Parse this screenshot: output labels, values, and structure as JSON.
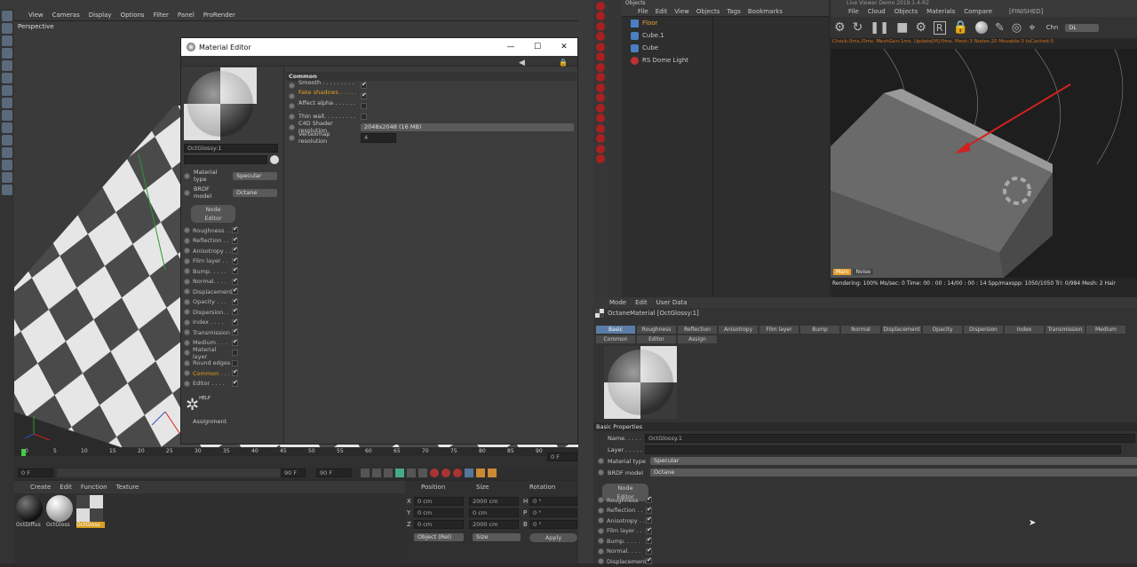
{
  "viewport": {
    "menu": [
      "View",
      "Cameras",
      "Display",
      "Options",
      "Filter",
      "Panel",
      "ProRender"
    ],
    "label": "Perspective"
  },
  "timeline": {
    "ticks": [
      "0",
      "5",
      "10",
      "15",
      "20",
      "25",
      "30",
      "35",
      "40",
      "45",
      "50",
      "55",
      "60",
      "65",
      "70",
      "75",
      "80",
      "85",
      "90"
    ],
    "end_field": "0 F",
    "start_field": "0 F",
    "range_end": "90 F",
    "current": "90 F",
    "range_start": "0 F"
  },
  "material_manager": {
    "menu": [
      "Create",
      "Edit",
      "Function",
      "Texture"
    ],
    "materials": [
      {
        "name": "OctDiffus"
      },
      {
        "name": "OctGloss"
      },
      {
        "name": "OctGloss",
        "selected": true
      }
    ]
  },
  "coordinates": {
    "headers": [
      "Position",
      "Size",
      "Rotation"
    ],
    "rows": [
      {
        "axis": "X",
        "pos": "0 cm",
        "size": "2000 cm",
        "rot_axis": "H",
        "rot": "0 °"
      },
      {
        "axis": "Y",
        "pos": "0 cm",
        "size": "0 cm",
        "rot_axis": "P",
        "rot": "0 °"
      },
      {
        "axis": "Z",
        "pos": "0 cm",
        "size": "2000 cm",
        "rot_axis": "B",
        "rot": "0 °"
      }
    ],
    "mode_drop": "Object (Rel)",
    "size_drop": "Size",
    "apply": "Apply"
  },
  "material_editor": {
    "title": "Material Editor",
    "window_controls": {
      "minimize": "—",
      "maximize": "☐",
      "close": "✕"
    },
    "name": "OctGlossy:1",
    "material_type_label": "Material type",
    "material_type": "Specular",
    "brdf_label": "BRDF model",
    "brdf": "Octane",
    "node_editor": "Node Editor",
    "channels": [
      {
        "label": "Roughness . .",
        "checked": true
      },
      {
        "label": "Reflection . .",
        "checked": true
      },
      {
        "label": "Anisotropy . .",
        "checked": true
      },
      {
        "label": "Film layer . .",
        "checked": true
      },
      {
        "label": "Bump. . . . .",
        "checked": true
      },
      {
        "label": "Normal. . . .",
        "checked": true
      },
      {
        "label": "Displacement",
        "checked": true
      },
      {
        "label": "Opacity . . .",
        "checked": true
      },
      {
        "label": "Dispersion. .",
        "checked": true
      },
      {
        "label": "Index . . . .",
        "checked": true
      },
      {
        "label": "Transmission",
        "checked": true
      },
      {
        "label": "Medium . . .",
        "checked": true
      },
      {
        "label": "Material layer",
        "checked": false
      },
      {
        "label": "Round edges",
        "checked": false
      },
      {
        "label": "Common . . .",
        "checked": true,
        "highlight": true
      },
      {
        "label": "Editor . . . .",
        "checked": true
      }
    ],
    "help": "HELP",
    "assignment": "Assignment",
    "section": "Common",
    "props": [
      {
        "label": "Smooth . . . . . . . . . .",
        "checked": true
      },
      {
        "label": "Fake shadows . . . . . .",
        "checked": true,
        "highlight": true
      },
      {
        "label": "Affect alpha . . . . . . .",
        "checked": false
      },
      {
        "label": "Thin wall. . . . . . . . .",
        "checked": false
      }
    ],
    "shader_res_label": "C4D Shader resolution",
    "shader_res": "2048x2048 (16 MB)",
    "vertexmap_label": "Vertexmap resolution",
    "vertexmap": "4"
  },
  "object_manager": {
    "title": "Objects",
    "menu": [
      "File",
      "Edit",
      "View",
      "Objects",
      "Tags",
      "Bookmarks"
    ],
    "objects": [
      {
        "name": "Floor",
        "highlight": true
      },
      {
        "name": "Cube.1"
      },
      {
        "name": "Cube"
      },
      {
        "name": "RS Dome Light"
      }
    ]
  },
  "live_viewer": {
    "title": "Live Viewer Demo 2019.1.4-R2",
    "menu": [
      "File",
      "Cloud",
      "Objects",
      "Materials",
      "Compare"
    ],
    "status_tag": "[FINISHED]",
    "channel_label": "Chn",
    "channel": "DL",
    "info_line": "Check:0ms./0ms. MeshGen:1ms. Update[M]:0ms. Mesh:3 Nodes:20 Movable:3 txCached:0",
    "tag_main": "Main",
    "tag_noise": "Noise",
    "render_status": "Rendering: 100%  Ms/sec: 0    Time: 00 : 00 : 14/00 : 00 : 14   Spp/maxspp: 1050/1050    Tri: 0/984    Mesh: 2   Hair"
  },
  "attributes": {
    "menu": [
      "Mode",
      "Edit",
      "User Data"
    ],
    "header": "OctaneMaterial [OctGlossy:1]",
    "tabs_row1": [
      "Basic",
      "Roughness",
      "Reflection",
      "Anisotropy",
      "Film layer",
      "Bump",
      "Normal",
      "Displacement",
      "Opacity",
      "Dispersion",
      "Index",
      "Transmission",
      "Medium"
    ],
    "tabs_row2": [
      "Common",
      "Editor",
      "Assign"
    ],
    "basic_props": "Basic Properties",
    "name_label": "Name. . . . .",
    "name_value": "OctGlossy.1",
    "layer_label": "Layer . . . . .",
    "mat_type_label": "Material type",
    "mat_type": "Specular",
    "brdf_label": "BRDF model",
    "brdf": "Octane",
    "node_editor": "Node Editor",
    "channels": [
      {
        "label": "Roughness",
        "checked": true
      },
      {
        "label": "Reflection . .",
        "checked": true
      },
      {
        "label": "Anisotropy . .",
        "checked": true
      },
      {
        "label": "Film layer . .",
        "checked": true
      },
      {
        "label": "Bump. . . . .",
        "checked": true
      },
      {
        "label": "Normal. . . .",
        "checked": true
      },
      {
        "label": "Displacement",
        "checked": true
      }
    ]
  }
}
